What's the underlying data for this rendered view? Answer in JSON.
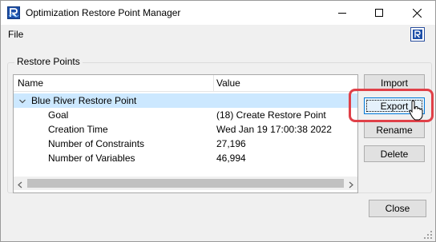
{
  "window": {
    "title": "Optimization Restore Point Manager",
    "icons": {
      "app": "riverware-app-icon",
      "minimize": "minimize-icon",
      "maximize": "maximize-icon",
      "close": "close-icon"
    }
  },
  "menubar": {
    "items": [
      {
        "label": "File"
      }
    ],
    "right_icon": "riverware-help-icon"
  },
  "restore_points": {
    "group_label": "Restore Points",
    "columns": {
      "name": "Name",
      "value": "Value"
    },
    "root": {
      "label": "Blue River Restore Point",
      "expanded": true,
      "selected": true,
      "children": [
        {
          "name": "Goal",
          "value": "(18) Create Restore Point"
        },
        {
          "name": "Creation Time",
          "value": "Wed Jan 19 17:00:38 2022"
        },
        {
          "name": "Number of Constraints",
          "value": "27,196"
        },
        {
          "name": "Number of Variables",
          "value": "46,994"
        }
      ]
    }
  },
  "actions": {
    "import": "Import",
    "export": "Export",
    "rename": "Rename",
    "delete": "Delete",
    "close": "Close"
  },
  "colors": {
    "selection": "#cce8ff",
    "highlight_ring": "#e04048",
    "focus_border": "#0078d7"
  }
}
